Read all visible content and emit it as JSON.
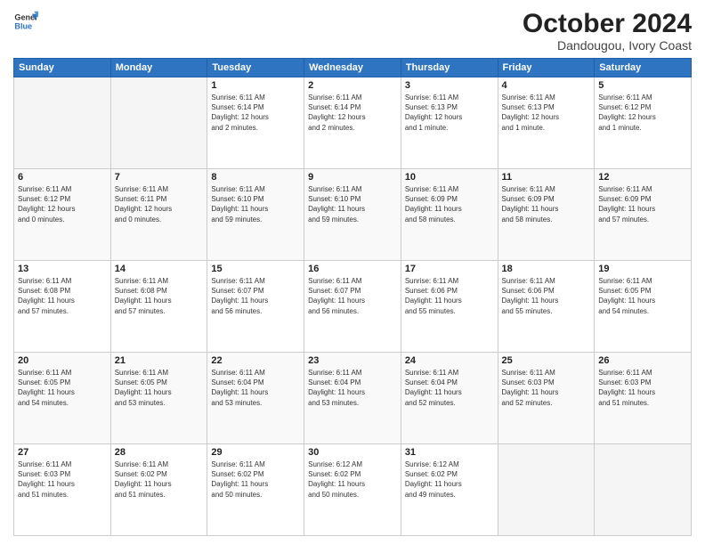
{
  "header": {
    "logo_line1": "General",
    "logo_line2": "Blue",
    "month_year": "October 2024",
    "location": "Dandougou, Ivory Coast"
  },
  "weekdays": [
    "Sunday",
    "Monday",
    "Tuesday",
    "Wednesday",
    "Thursday",
    "Friday",
    "Saturday"
  ],
  "weeks": [
    [
      {
        "day": "",
        "info": ""
      },
      {
        "day": "",
        "info": ""
      },
      {
        "day": "1",
        "info": "Sunrise: 6:11 AM\nSunset: 6:14 PM\nDaylight: 12 hours\nand 2 minutes."
      },
      {
        "day": "2",
        "info": "Sunrise: 6:11 AM\nSunset: 6:14 PM\nDaylight: 12 hours\nand 2 minutes."
      },
      {
        "day": "3",
        "info": "Sunrise: 6:11 AM\nSunset: 6:13 PM\nDaylight: 12 hours\nand 1 minute."
      },
      {
        "day": "4",
        "info": "Sunrise: 6:11 AM\nSunset: 6:13 PM\nDaylight: 12 hours\nand 1 minute."
      },
      {
        "day": "5",
        "info": "Sunrise: 6:11 AM\nSunset: 6:12 PM\nDaylight: 12 hours\nand 1 minute."
      }
    ],
    [
      {
        "day": "6",
        "info": "Sunrise: 6:11 AM\nSunset: 6:12 PM\nDaylight: 12 hours\nand 0 minutes."
      },
      {
        "day": "7",
        "info": "Sunrise: 6:11 AM\nSunset: 6:11 PM\nDaylight: 12 hours\nand 0 minutes."
      },
      {
        "day": "8",
        "info": "Sunrise: 6:11 AM\nSunset: 6:10 PM\nDaylight: 11 hours\nand 59 minutes."
      },
      {
        "day": "9",
        "info": "Sunrise: 6:11 AM\nSunset: 6:10 PM\nDaylight: 11 hours\nand 59 minutes."
      },
      {
        "day": "10",
        "info": "Sunrise: 6:11 AM\nSunset: 6:09 PM\nDaylight: 11 hours\nand 58 minutes."
      },
      {
        "day": "11",
        "info": "Sunrise: 6:11 AM\nSunset: 6:09 PM\nDaylight: 11 hours\nand 58 minutes."
      },
      {
        "day": "12",
        "info": "Sunrise: 6:11 AM\nSunset: 6:09 PM\nDaylight: 11 hours\nand 57 minutes."
      }
    ],
    [
      {
        "day": "13",
        "info": "Sunrise: 6:11 AM\nSunset: 6:08 PM\nDaylight: 11 hours\nand 57 minutes."
      },
      {
        "day": "14",
        "info": "Sunrise: 6:11 AM\nSunset: 6:08 PM\nDaylight: 11 hours\nand 57 minutes."
      },
      {
        "day": "15",
        "info": "Sunrise: 6:11 AM\nSunset: 6:07 PM\nDaylight: 11 hours\nand 56 minutes."
      },
      {
        "day": "16",
        "info": "Sunrise: 6:11 AM\nSunset: 6:07 PM\nDaylight: 11 hours\nand 56 minutes."
      },
      {
        "day": "17",
        "info": "Sunrise: 6:11 AM\nSunset: 6:06 PM\nDaylight: 11 hours\nand 55 minutes."
      },
      {
        "day": "18",
        "info": "Sunrise: 6:11 AM\nSunset: 6:06 PM\nDaylight: 11 hours\nand 55 minutes."
      },
      {
        "day": "19",
        "info": "Sunrise: 6:11 AM\nSunset: 6:05 PM\nDaylight: 11 hours\nand 54 minutes."
      }
    ],
    [
      {
        "day": "20",
        "info": "Sunrise: 6:11 AM\nSunset: 6:05 PM\nDaylight: 11 hours\nand 54 minutes."
      },
      {
        "day": "21",
        "info": "Sunrise: 6:11 AM\nSunset: 6:05 PM\nDaylight: 11 hours\nand 53 minutes."
      },
      {
        "day": "22",
        "info": "Sunrise: 6:11 AM\nSunset: 6:04 PM\nDaylight: 11 hours\nand 53 minutes."
      },
      {
        "day": "23",
        "info": "Sunrise: 6:11 AM\nSunset: 6:04 PM\nDaylight: 11 hours\nand 53 minutes."
      },
      {
        "day": "24",
        "info": "Sunrise: 6:11 AM\nSunset: 6:04 PM\nDaylight: 11 hours\nand 52 minutes."
      },
      {
        "day": "25",
        "info": "Sunrise: 6:11 AM\nSunset: 6:03 PM\nDaylight: 11 hours\nand 52 minutes."
      },
      {
        "day": "26",
        "info": "Sunrise: 6:11 AM\nSunset: 6:03 PM\nDaylight: 11 hours\nand 51 minutes."
      }
    ],
    [
      {
        "day": "27",
        "info": "Sunrise: 6:11 AM\nSunset: 6:03 PM\nDaylight: 11 hours\nand 51 minutes."
      },
      {
        "day": "28",
        "info": "Sunrise: 6:11 AM\nSunset: 6:02 PM\nDaylight: 11 hours\nand 51 minutes."
      },
      {
        "day": "29",
        "info": "Sunrise: 6:11 AM\nSunset: 6:02 PM\nDaylight: 11 hours\nand 50 minutes."
      },
      {
        "day": "30",
        "info": "Sunrise: 6:12 AM\nSunset: 6:02 PM\nDaylight: 11 hours\nand 50 minutes."
      },
      {
        "day": "31",
        "info": "Sunrise: 6:12 AM\nSunset: 6:02 PM\nDaylight: 11 hours\nand 49 minutes."
      },
      {
        "day": "",
        "info": ""
      },
      {
        "day": "",
        "info": ""
      }
    ]
  ]
}
